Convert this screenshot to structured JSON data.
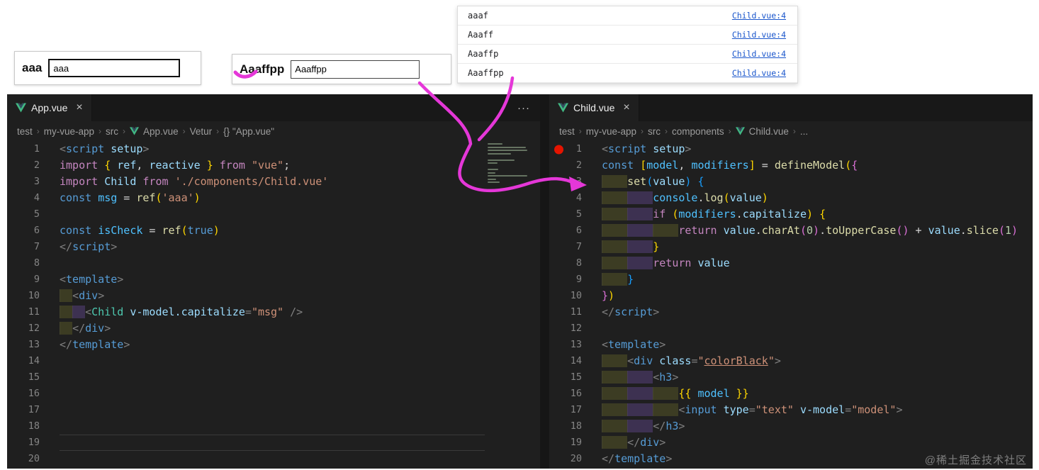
{
  "widgets": {
    "box1": {
      "label": "aaa",
      "value": "aaa"
    },
    "box2": {
      "label": "Aaaffpp",
      "value": "Aaaffpp"
    }
  },
  "console": {
    "rows": [
      {
        "text": "aaaf",
        "link": "Child.vue:4"
      },
      {
        "text": "Aaaff",
        "link": "Child.vue:4"
      },
      {
        "text": "Aaaffp",
        "link": "Child.vue:4"
      },
      {
        "text": "Aaaffpp",
        "link": "Child.vue:4"
      }
    ]
  },
  "icons": {
    "close": "×",
    "more": "···",
    "separator": "›"
  },
  "colors": {
    "annotation_pink": "#e537d8",
    "breakpoint_red": "#e51400",
    "link_blue": "#1a56cc",
    "editor_bg": "#1f1f1f"
  },
  "editor": {
    "left": {
      "tab": "App.vue",
      "unit": 2,
      "active_line": 19,
      "breadcrumb": [
        {
          "label": "test"
        },
        {
          "label": "my-vue-app"
        },
        {
          "label": "src"
        },
        {
          "label": "App.vue",
          "icon": "vue"
        },
        {
          "label": "Vetur"
        },
        {
          "label": "{} \"App.vue\""
        }
      ],
      "lines": [
        {
          "ind": 0,
          "t": [
            [
              "<",
              "p"
            ],
            [
              "script",
              "tag"
            ],
            [
              " setup",
              "attr"
            ],
            [
              ">",
              "p"
            ]
          ]
        },
        {
          "ind": 0,
          "t": [
            [
              "import",
              "kw"
            ],
            [
              " ",
              "pl"
            ],
            [
              "{",
              "brY"
            ],
            [
              " ref",
              "attr"
            ],
            [
              ",",
              "pl"
            ],
            [
              " reactive ",
              "attr"
            ],
            [
              "}",
              "brY"
            ],
            [
              " ",
              "pl"
            ],
            [
              "from",
              "kw"
            ],
            [
              " ",
              "pl"
            ],
            [
              "\"vue\"",
              "str"
            ],
            [
              ";",
              "pl"
            ]
          ]
        },
        {
          "ind": 0,
          "t": [
            [
              "import",
              "kw"
            ],
            [
              " ",
              "pl"
            ],
            [
              "Child",
              "attr"
            ],
            [
              " ",
              "pl"
            ],
            [
              "from",
              "kw"
            ],
            [
              " ",
              "pl"
            ],
            [
              "'./components/Child.vue'",
              "str"
            ]
          ]
        },
        {
          "ind": 0,
          "t": [
            [
              "const",
              "kwb"
            ],
            [
              " ",
              "pl"
            ],
            [
              "msg",
              "varc"
            ],
            [
              " = ",
              "pl"
            ],
            [
              "ref",
              "fn"
            ],
            [
              "(",
              "brY"
            ],
            [
              "'aaa'",
              "str"
            ],
            [
              ")",
              "brY"
            ]
          ]
        },
        {
          "ind": 0,
          "t": []
        },
        {
          "ind": 0,
          "t": [
            [
              "const",
              "kwb"
            ],
            [
              " ",
              "pl"
            ],
            [
              "isCheck",
              "varc"
            ],
            [
              " = ",
              "pl"
            ],
            [
              "ref",
              "fn"
            ],
            [
              "(",
              "brY"
            ],
            [
              "true",
              "kwb"
            ],
            [
              ")",
              "brY"
            ]
          ]
        },
        {
          "ind": 0,
          "t": [
            [
              "</",
              "p"
            ],
            [
              "script",
              "tag"
            ],
            [
              ">",
              "p"
            ]
          ]
        },
        {
          "ind": 0,
          "t": []
        },
        {
          "ind": 0,
          "t": [
            [
              "<",
              "p"
            ],
            [
              "template",
              "tag"
            ],
            [
              ">",
              "p"
            ]
          ]
        },
        {
          "ind": 1,
          "t": [
            [
              "<",
              "p"
            ],
            [
              "div",
              "tag"
            ],
            [
              ">",
              "p"
            ]
          ]
        },
        {
          "ind": 2,
          "t": [
            [
              "<",
              "p"
            ],
            [
              "Child",
              "comp"
            ],
            [
              " ",
              "pl"
            ],
            [
              "v-model.capitalize",
              "attr"
            ],
            [
              "=",
              "p"
            ],
            [
              "\"msg\"",
              "str"
            ],
            [
              " ",
              "pl"
            ],
            [
              "/>",
              "p"
            ]
          ]
        },
        {
          "ind": 1,
          "t": [
            [
              "</",
              "p"
            ],
            [
              "div",
              "tag"
            ],
            [
              ">",
              "p"
            ]
          ]
        },
        {
          "ind": 0,
          "t": [
            [
              "</",
              "p"
            ],
            [
              "template",
              "tag"
            ],
            [
              ">",
              "p"
            ]
          ]
        },
        {
          "ind": 0,
          "t": []
        },
        {
          "ind": 0,
          "t": []
        },
        {
          "ind": 0,
          "t": []
        },
        {
          "ind": 0,
          "t": []
        },
        {
          "ind": 0,
          "t": []
        },
        {
          "ind": 0,
          "t": []
        },
        {
          "ind": 0,
          "t": []
        }
      ]
    },
    "right": {
      "tab": "Child.vue",
      "unit": 4,
      "breakpoint_line": 1,
      "breadcrumb": [
        {
          "label": "test"
        },
        {
          "label": "my-vue-app"
        },
        {
          "label": "src"
        },
        {
          "label": "components"
        },
        {
          "label": "Child.vue",
          "icon": "vue"
        },
        {
          "label": "..."
        }
      ],
      "lines": [
        {
          "ind": 0,
          "t": [
            [
              "<",
              "p"
            ],
            [
              "script",
              "tag"
            ],
            [
              " setup",
              "attr"
            ],
            [
              ">",
              "p"
            ]
          ]
        },
        {
          "ind": 0,
          "t": [
            [
              "const",
              "kwb"
            ],
            [
              " ",
              "pl"
            ],
            [
              "[",
              "brY"
            ],
            [
              "model",
              "varc"
            ],
            [
              ", ",
              "pl"
            ],
            [
              "modifiers",
              "varc"
            ],
            [
              "]",
              "brY"
            ],
            [
              " = ",
              "pl"
            ],
            [
              "defineModel",
              "fn"
            ],
            [
              "(",
              "brY"
            ],
            [
              "{",
              "brP"
            ]
          ]
        },
        {
          "ind": 1,
          "t": [
            [
              "set",
              "fn"
            ],
            [
              "(",
              "brB"
            ],
            [
              "value",
              "attr"
            ],
            [
              ")",
              "brB"
            ],
            [
              " ",
              "pl"
            ],
            [
              "{",
              "brB"
            ]
          ]
        },
        {
          "ind": 2,
          "t": [
            [
              "console",
              "varc"
            ],
            [
              ".",
              "pl"
            ],
            [
              "log",
              "fn"
            ],
            [
              "(",
              "brY"
            ],
            [
              "value",
              "attr"
            ],
            [
              ")",
              "brY"
            ]
          ]
        },
        {
          "ind": 2,
          "t": [
            [
              "if",
              "kw"
            ],
            [
              " ",
              "pl"
            ],
            [
              "(",
              "brY"
            ],
            [
              "modifiers",
              "varc"
            ],
            [
              ".",
              "pl"
            ],
            [
              "capitalize",
              "attr"
            ],
            [
              ")",
              "brY"
            ],
            [
              " ",
              "pl"
            ],
            [
              "{",
              "brY"
            ]
          ]
        },
        {
          "ind": 3,
          "t": [
            [
              "return",
              "kw"
            ],
            [
              " ",
              "pl"
            ],
            [
              "value",
              "attr"
            ],
            [
              ".",
              "pl"
            ],
            [
              "charAt",
              "fn"
            ],
            [
              "(",
              "brP"
            ],
            [
              "0",
              "num"
            ],
            [
              ")",
              "brP"
            ],
            [
              ".",
              "pl"
            ],
            [
              "toUpperCase",
              "fn"
            ],
            [
              "(",
              "brP"
            ],
            [
              ")",
              "brP"
            ],
            [
              " + ",
              "pl"
            ],
            [
              "value",
              "attr"
            ],
            [
              ".",
              "pl"
            ],
            [
              "slice",
              "fn"
            ],
            [
              "(",
              "brP"
            ],
            [
              "1",
              "num"
            ],
            [
              ")",
              "brP"
            ]
          ]
        },
        {
          "ind": 2,
          "t": [
            [
              "}",
              "brY"
            ]
          ]
        },
        {
          "ind": 2,
          "t": [
            [
              "return",
              "kw"
            ],
            [
              " ",
              "pl"
            ],
            [
              "value",
              "attr"
            ]
          ]
        },
        {
          "ind": 1,
          "t": [
            [
              "}",
              "brB"
            ]
          ]
        },
        {
          "ind": 0,
          "t": [
            [
              "}",
              "brP"
            ],
            [
              ")",
              "brY"
            ]
          ]
        },
        {
          "ind": 0,
          "t": [
            [
              "</",
              "p"
            ],
            [
              "script",
              "tag"
            ],
            [
              ">",
              "p"
            ]
          ]
        },
        {
          "ind": 0,
          "t": []
        },
        {
          "ind": 0,
          "t": [
            [
              "<",
              "p"
            ],
            [
              "template",
              "tag"
            ],
            [
              ">",
              "p"
            ]
          ]
        },
        {
          "ind": 1,
          "t": [
            [
              "<",
              "p"
            ],
            [
              "div",
              "tag"
            ],
            [
              " ",
              "pl"
            ],
            [
              "class",
              "attr"
            ],
            [
              "=",
              "p"
            ],
            [
              "\"",
              "str"
            ],
            [
              "colorBlack",
              "strU"
            ],
            [
              "\"",
              "str"
            ],
            [
              ">",
              "p"
            ]
          ]
        },
        {
          "ind": 2,
          "t": [
            [
              "<",
              "p"
            ],
            [
              "h3",
              "tag"
            ],
            [
              ">",
              "p"
            ]
          ]
        },
        {
          "ind": 3,
          "t": [
            [
              "{{",
              "brY"
            ],
            [
              " ",
              "pl"
            ],
            [
              "model",
              "varc"
            ],
            [
              " ",
              "pl"
            ],
            [
              "}}",
              "brY"
            ]
          ]
        },
        {
          "ind": 3,
          "t": [
            [
              "<",
              "p"
            ],
            [
              "input",
              "tag"
            ],
            [
              " ",
              "pl"
            ],
            [
              "type",
              "attr"
            ],
            [
              "=",
              "p"
            ],
            [
              "\"text\"",
              "str"
            ],
            [
              " ",
              "pl"
            ],
            [
              "v-model",
              "attr"
            ],
            [
              "=",
              "p"
            ],
            [
              "\"model\"",
              "str"
            ],
            [
              ">",
              "p"
            ]
          ]
        },
        {
          "ind": 2,
          "t": [
            [
              "</",
              "p"
            ],
            [
              "h3",
              "tag"
            ],
            [
              ">",
              "p"
            ]
          ]
        },
        {
          "ind": 1,
          "t": [
            [
              "</",
              "p"
            ],
            [
              "div",
              "tag"
            ],
            [
              ">",
              "p"
            ]
          ]
        },
        {
          "ind": 0,
          "t": [
            [
              "</",
              "p"
            ],
            [
              "template",
              "tag"
            ],
            [
              ">",
              "p"
            ]
          ]
        }
      ]
    }
  },
  "watermark": "@稀土掘金技术社区"
}
